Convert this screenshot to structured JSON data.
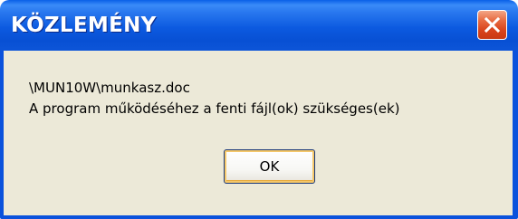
{
  "dialog": {
    "title": "KÖZLEMÉNY",
    "message_lines": [
      "\\MUN10W\\munkasz.doc",
      "A program működéséhez a fenti fájl(ok) szükséges(ek)"
    ],
    "ok_label": "OK",
    "close_icon": "close-icon"
  },
  "colors": {
    "titlebar": "#0c5ae0",
    "close_button": "#e05a30",
    "dialog_background": "#ece9d8",
    "frame": "#0a52dc"
  }
}
